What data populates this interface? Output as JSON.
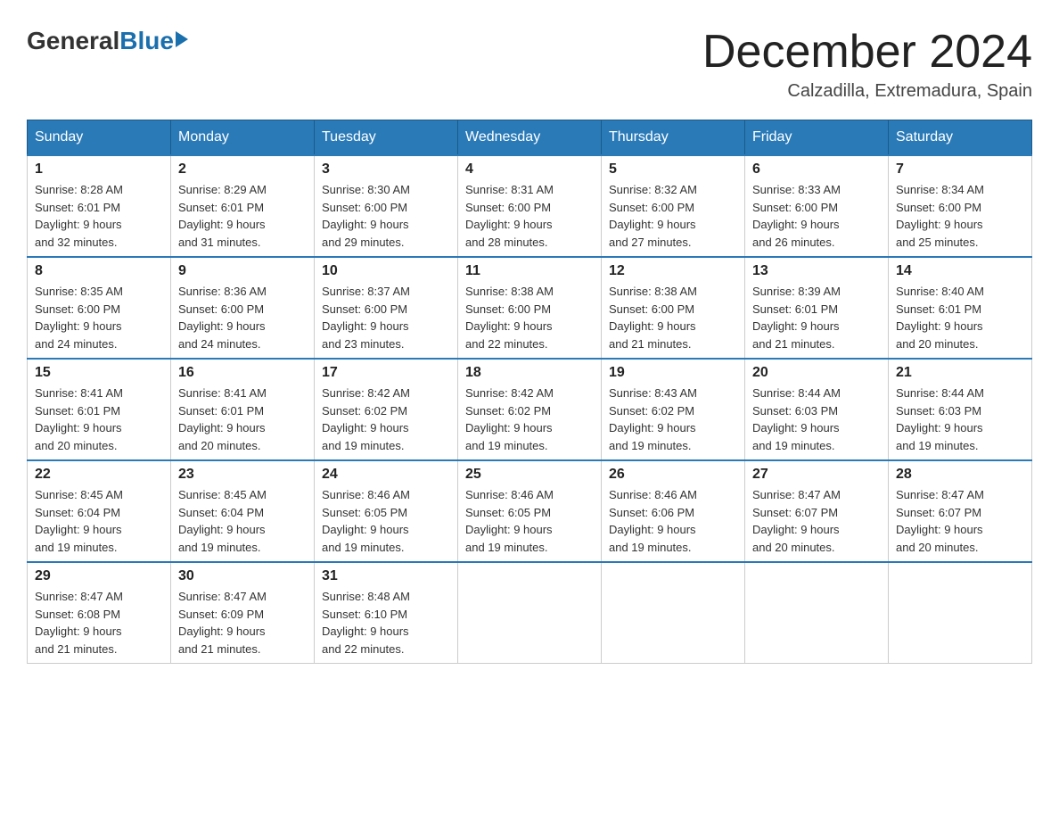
{
  "header": {
    "logo_general": "General",
    "logo_blue": "Blue",
    "month_title": "December 2024",
    "location": "Calzadilla, Extremadura, Spain"
  },
  "days_of_week": [
    "Sunday",
    "Monday",
    "Tuesday",
    "Wednesday",
    "Thursday",
    "Friday",
    "Saturday"
  ],
  "weeks": [
    [
      {
        "day": "1",
        "sunrise": "8:28 AM",
        "sunset": "6:01 PM",
        "daylight": "9 hours and 32 minutes."
      },
      {
        "day": "2",
        "sunrise": "8:29 AM",
        "sunset": "6:01 PM",
        "daylight": "9 hours and 31 minutes."
      },
      {
        "day": "3",
        "sunrise": "8:30 AM",
        "sunset": "6:00 PM",
        "daylight": "9 hours and 29 minutes."
      },
      {
        "day": "4",
        "sunrise": "8:31 AM",
        "sunset": "6:00 PM",
        "daylight": "9 hours and 28 minutes."
      },
      {
        "day": "5",
        "sunrise": "8:32 AM",
        "sunset": "6:00 PM",
        "daylight": "9 hours and 27 minutes."
      },
      {
        "day": "6",
        "sunrise": "8:33 AM",
        "sunset": "6:00 PM",
        "daylight": "9 hours and 26 minutes."
      },
      {
        "day": "7",
        "sunrise": "8:34 AM",
        "sunset": "6:00 PM",
        "daylight": "9 hours and 25 minutes."
      }
    ],
    [
      {
        "day": "8",
        "sunrise": "8:35 AM",
        "sunset": "6:00 PM",
        "daylight": "9 hours and 24 minutes."
      },
      {
        "day": "9",
        "sunrise": "8:36 AM",
        "sunset": "6:00 PM",
        "daylight": "9 hours and 24 minutes."
      },
      {
        "day": "10",
        "sunrise": "8:37 AM",
        "sunset": "6:00 PM",
        "daylight": "9 hours and 23 minutes."
      },
      {
        "day": "11",
        "sunrise": "8:38 AM",
        "sunset": "6:00 PM",
        "daylight": "9 hours and 22 minutes."
      },
      {
        "day": "12",
        "sunrise": "8:38 AM",
        "sunset": "6:00 PM",
        "daylight": "9 hours and 21 minutes."
      },
      {
        "day": "13",
        "sunrise": "8:39 AM",
        "sunset": "6:01 PM",
        "daylight": "9 hours and 21 minutes."
      },
      {
        "day": "14",
        "sunrise": "8:40 AM",
        "sunset": "6:01 PM",
        "daylight": "9 hours and 20 minutes."
      }
    ],
    [
      {
        "day": "15",
        "sunrise": "8:41 AM",
        "sunset": "6:01 PM",
        "daylight": "9 hours and 20 minutes."
      },
      {
        "day": "16",
        "sunrise": "8:41 AM",
        "sunset": "6:01 PM",
        "daylight": "9 hours and 20 minutes."
      },
      {
        "day": "17",
        "sunrise": "8:42 AM",
        "sunset": "6:02 PM",
        "daylight": "9 hours and 19 minutes."
      },
      {
        "day": "18",
        "sunrise": "8:42 AM",
        "sunset": "6:02 PM",
        "daylight": "9 hours and 19 minutes."
      },
      {
        "day": "19",
        "sunrise": "8:43 AM",
        "sunset": "6:02 PM",
        "daylight": "9 hours and 19 minutes."
      },
      {
        "day": "20",
        "sunrise": "8:44 AM",
        "sunset": "6:03 PM",
        "daylight": "9 hours and 19 minutes."
      },
      {
        "day": "21",
        "sunrise": "8:44 AM",
        "sunset": "6:03 PM",
        "daylight": "9 hours and 19 minutes."
      }
    ],
    [
      {
        "day": "22",
        "sunrise": "8:45 AM",
        "sunset": "6:04 PM",
        "daylight": "9 hours and 19 minutes."
      },
      {
        "day": "23",
        "sunrise": "8:45 AM",
        "sunset": "6:04 PM",
        "daylight": "9 hours and 19 minutes."
      },
      {
        "day": "24",
        "sunrise": "8:46 AM",
        "sunset": "6:05 PM",
        "daylight": "9 hours and 19 minutes."
      },
      {
        "day": "25",
        "sunrise": "8:46 AM",
        "sunset": "6:05 PM",
        "daylight": "9 hours and 19 minutes."
      },
      {
        "day": "26",
        "sunrise": "8:46 AM",
        "sunset": "6:06 PM",
        "daylight": "9 hours and 19 minutes."
      },
      {
        "day": "27",
        "sunrise": "8:47 AM",
        "sunset": "6:07 PM",
        "daylight": "9 hours and 20 minutes."
      },
      {
        "day": "28",
        "sunrise": "8:47 AM",
        "sunset": "6:07 PM",
        "daylight": "9 hours and 20 minutes."
      }
    ],
    [
      {
        "day": "29",
        "sunrise": "8:47 AM",
        "sunset": "6:08 PM",
        "daylight": "9 hours and 21 minutes."
      },
      {
        "day": "30",
        "sunrise": "8:47 AM",
        "sunset": "6:09 PM",
        "daylight": "9 hours and 21 minutes."
      },
      {
        "day": "31",
        "sunrise": "8:48 AM",
        "sunset": "6:10 PM",
        "daylight": "9 hours and 22 minutes."
      },
      null,
      null,
      null,
      null
    ]
  ],
  "labels": {
    "sunrise": "Sunrise:",
    "sunset": "Sunset:",
    "daylight": "Daylight:"
  }
}
